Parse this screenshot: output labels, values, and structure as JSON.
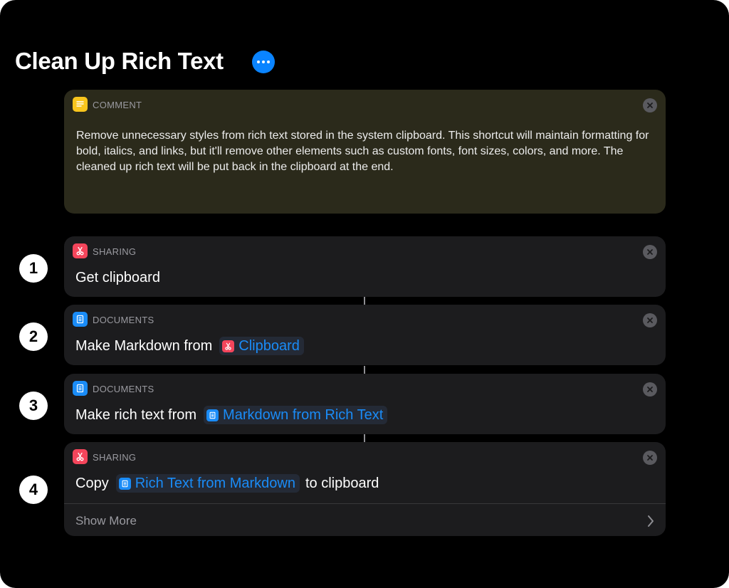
{
  "title": "Clean Up Rich Text",
  "colors": {
    "accent": "#0a84ff",
    "comment_icon": "#f9c51d",
    "sharing_icon": "#f4455b",
    "documents_icon": "#1a8cf7"
  },
  "comment": {
    "category": "COMMENT",
    "icon": "comment-lines-icon",
    "text": "Remove unnecessary styles from rich text stored in the system clipboard. This shortcut will maintain formatting for bold, italics, and links, but it'll remove other elements such as custom fonts, font sizes, colors, and more. The cleaned up rich text will be put back in the clipboard at the end."
  },
  "actions": [
    {
      "step": "1",
      "category": "SHARING",
      "icon": "scissors-icon",
      "prefix": "Get clipboard"
    },
    {
      "step": "2",
      "category": "DOCUMENTS",
      "icon": "document-icon",
      "prefix": "Make Markdown from",
      "variable": "Clipboard",
      "variable_icon": "scissors-icon"
    },
    {
      "step": "3",
      "category": "DOCUMENTS",
      "icon": "document-icon",
      "prefix": "Make rich text from",
      "variable": "Markdown from Rich Text",
      "variable_icon": "document-icon"
    },
    {
      "step": "4",
      "category": "SHARING",
      "icon": "scissors-icon",
      "prefix": "Copy",
      "variable": "Rich Text from Markdown",
      "variable_icon": "document-icon",
      "suffix": "to clipboard",
      "show_more": "Show More"
    }
  ]
}
